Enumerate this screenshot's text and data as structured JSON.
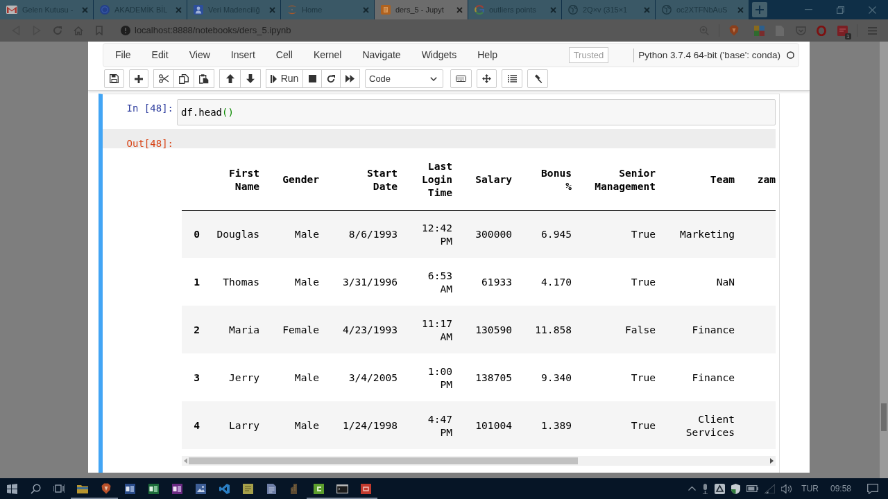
{
  "browser": {
    "tabs": [
      {
        "title": "Gelen Kutusu -",
        "kind": "mail",
        "selected": false
      },
      {
        "title": "AKADEMİK BİL",
        "kind": "emblem",
        "selected": false
      },
      {
        "title": "Veri Madenciliğ",
        "kind": "person",
        "selected": false
      },
      {
        "title": "Home",
        "kind": "jupyter",
        "selected": false
      },
      {
        "title": "ders_5 - Jupyt",
        "kind": "notebook",
        "selected": true
      },
      {
        "title": "outliers points",
        "kind": "google",
        "selected": false
      },
      {
        "title": "2Q×v (315×1",
        "kind": "globe",
        "selected": false
      },
      {
        "title": "oc2XTFNbAuS",
        "kind": "globe",
        "selected": false
      }
    ],
    "address": "localhost:8888/notebooks/ders_5.ipynb",
    "extension_badge": "1"
  },
  "notebook": {
    "menu": [
      "File",
      "Edit",
      "View",
      "Insert",
      "Cell",
      "Kernel",
      "Navigate",
      "Widgets",
      "Help"
    ],
    "trusted": "Trusted",
    "kernel": "Python 3.7.4 64-bit ('base': conda)",
    "toolbar": {
      "run": "Run",
      "cell_type": "Code"
    },
    "cell": {
      "selected": true,
      "in_prompt": "In [48]:",
      "code": [
        {
          "text": "df.head",
          "kind": "name"
        },
        {
          "text": "()",
          "kind": "paren"
        }
      ],
      "out_prompt": "Out[48]:",
      "table": {
        "columns": [
          "First Name",
          "Gender",
          "Start Date",
          "Last Login Time",
          "Salary",
          "Bonus %",
          "Senior Management",
          "Team",
          "zam"
        ],
        "rows": [
          {
            "index": "0",
            "cells": [
              "Douglas",
              "Male",
              "8/6/1993",
              "12:42 PM",
              "300000",
              "6.945",
              "True",
              "Marketing"
            ]
          },
          {
            "index": "1",
            "cells": [
              "Thomas",
              "Male",
              "3/31/1996",
              "6:53 AM",
              "61933",
              "4.170",
              "True",
              "NaN"
            ]
          },
          {
            "index": "2",
            "cells": [
              "Maria",
              "Female",
              "4/23/1993",
              "11:17 AM",
              "130590",
              "11.858",
              "False",
              "Finance"
            ]
          },
          {
            "index": "3",
            "cells": [
              "Jerry",
              "Male",
              "3/4/2005",
              "1:00 PM",
              "138705",
              "9.340",
              "True",
              "Finance"
            ]
          },
          {
            "index": "4",
            "cells": [
              "Larry",
              "Male",
              "1/24/1998",
              "4:47 PM",
              "101004",
              "1.389",
              "True",
              "Client Services"
            ]
          }
        ]
      }
    }
  },
  "taskbar": {
    "apps": [
      {
        "kind": "start",
        "running": false
      },
      {
        "kind": "search",
        "running": false
      },
      {
        "kind": "taskview",
        "running": false
      },
      {
        "kind": "folder",
        "running": true
      },
      {
        "kind": "shield",
        "running": true
      },
      {
        "kind": "word",
        "running": false
      },
      {
        "kind": "sheet",
        "running": false
      },
      {
        "kind": "note",
        "running": false
      },
      {
        "kind": "photo",
        "running": false
      },
      {
        "kind": "code",
        "running": false
      },
      {
        "kind": "notepad",
        "running": false
      },
      {
        "kind": "doc",
        "running": false
      },
      {
        "kind": "building",
        "running": false
      },
      {
        "kind": "greenapp",
        "running": true
      },
      {
        "kind": "terminal",
        "running": true
      },
      {
        "kind": "redapp",
        "running": true
      }
    ],
    "language": "TUR",
    "time": "09:58"
  }
}
